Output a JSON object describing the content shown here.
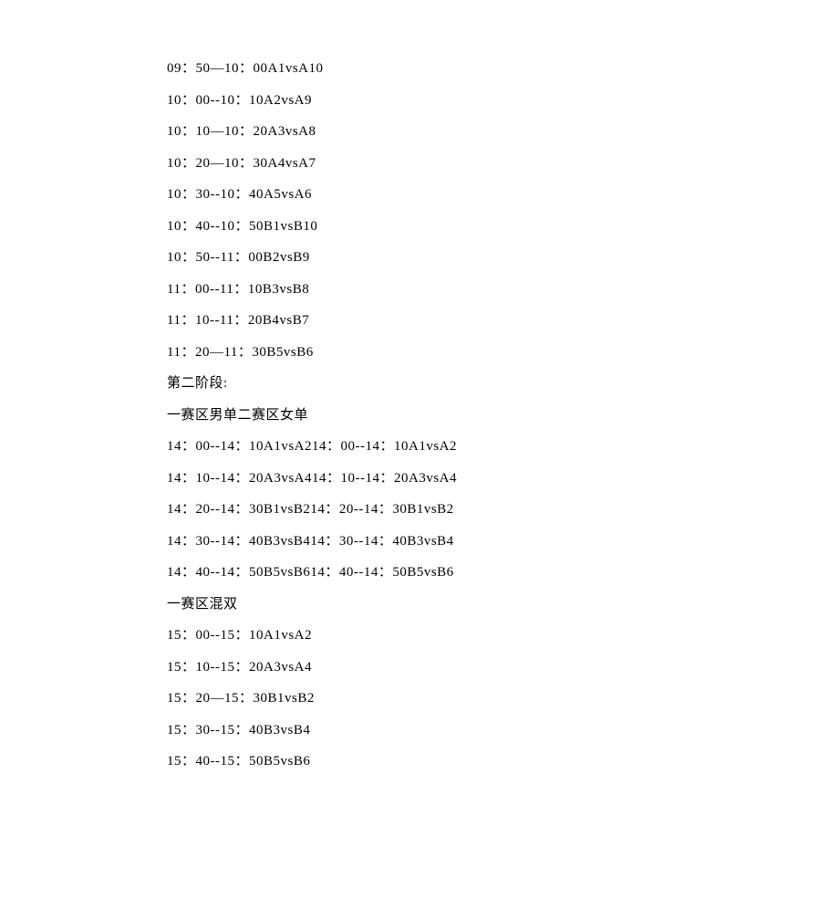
{
  "lines": [
    "09：50—10：00A1vsA10",
    "10：00--10：10A2vsA9",
    "10：10—10：20A3vsA8",
    "10：20—10：30A4vsA7",
    "10：30--10：40A5vsA6",
    "10：40--10：50B1vsB10",
    "10：50--11：00B2vsB9",
    "11：00--11：10B3vsB8",
    "11：10--11：20B4vsB7",
    "11：20—11：30B5vsB6",
    "第二阶段:",
    "一赛区男单二赛区女单",
    "14：00--14：10A1vsA214：00--14：10A1vsA2",
    "14：10--14：20A3vsA414：10--14：20A3vsA4",
    "14：20--14：30B1vsB214：20--14：30B1vsB2",
    "14：30--14：40B3vsB414：30--14：40B3vsB4",
    "14：40--14：50B5vsB614：40--14：50B5vsB6",
    "一赛区混双",
    "15：00--15：10A1vsA2",
    "15：10--15：20A3vsA4",
    "15：20—15：30B1vsB2",
    "15：30--15：40B3vsB4",
    "15：40--15：50B5vsB6"
  ]
}
